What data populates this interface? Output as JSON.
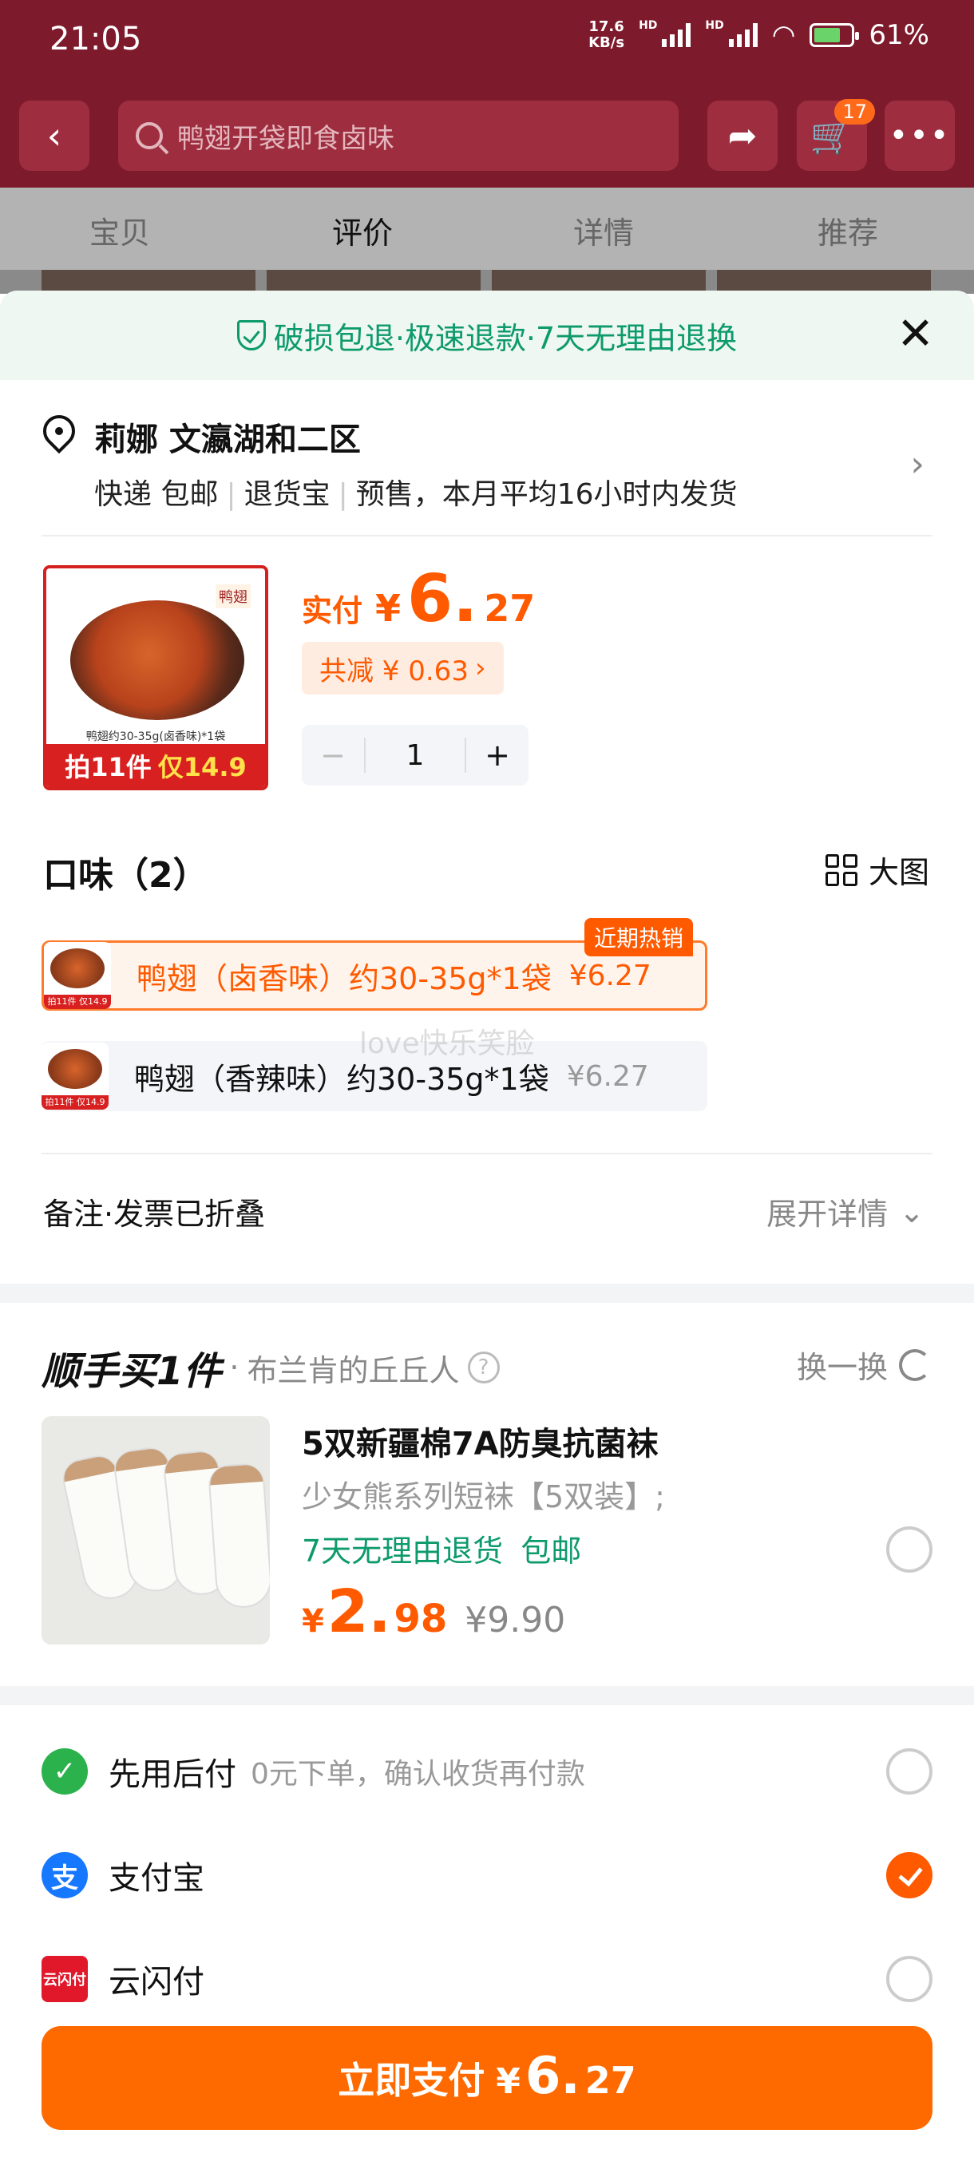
{
  "status_bar": {
    "time": "21:05",
    "net_speed_top": "17.6",
    "net_speed_unit": "KB/s",
    "hd": "HD",
    "battery": "61%"
  },
  "nav": {
    "search_placeholder": "鸭翅开袋即食卤味",
    "cart_count": "17"
  },
  "tabs": [
    "宝贝",
    "评价",
    "详情",
    "推荐"
  ],
  "sheet": {
    "guarantee": "破损包退·极速退款·7天无理由退换",
    "address": {
      "name": "莉娜 文瀛湖和二区",
      "shipping": "快递 包邮",
      "return": "退货宝",
      "presale": "预售，本月平均16小时内发货"
    },
    "product": {
      "img_tag": "鸭翅",
      "img_caption": "鸭翅约30-35g(卤香味)*1袋",
      "img_promo_a": "拍11件",
      "img_promo_b": "仅14.9",
      "price_label": "实付",
      "currency": "¥",
      "price_int": "6.",
      "price_dec": "27",
      "discount": "共减 ¥ 0.63",
      "quantity": "1"
    },
    "flavor": {
      "title": "口味（2）",
      "big_view": "大图",
      "hot_badge": "近期热销",
      "options": [
        {
          "name": "鸭翅（卤香味）约30-35g*1袋",
          "price": "¥6.27",
          "thumb_promo": "拍11件 仅14.9",
          "selected": true
        },
        {
          "name": "鸭翅（香辣味）约30-35g*1袋",
          "price": "¥6.27",
          "thumb_promo": "拍11件 仅14.9",
          "selected": false
        }
      ]
    },
    "watermark": "love快乐笑脸",
    "note": {
      "label": "备注·发票已折叠",
      "expand": "展开详情"
    },
    "addon": {
      "title": "顺手买1件",
      "shop": "布兰肯的丘丘人",
      "swap": "换一换",
      "name": "5双新疆棉7A防臭抗菌袜",
      "desc": "少女熊系列短袜【5双装】;",
      "tag1": "7天无理由退货",
      "tag2": "包邮",
      "currency": "¥",
      "price_int": "2.",
      "price_dec": "98",
      "orig_price": "¥9.90"
    },
    "payments": [
      {
        "name": "先用后付",
        "sub": "0元下单，确认收货再付款",
        "icon_text": "✓",
        "checked": false
      },
      {
        "name": "支付宝",
        "sub": "",
        "icon_text": "支",
        "checked": true
      },
      {
        "name": "云闪付",
        "sub": "",
        "icon_text": "云闪付",
        "checked": false
      }
    ],
    "pay_button": {
      "label": "立即支付",
      "currency": "¥",
      "int": "6.",
      "dec": "27"
    }
  }
}
